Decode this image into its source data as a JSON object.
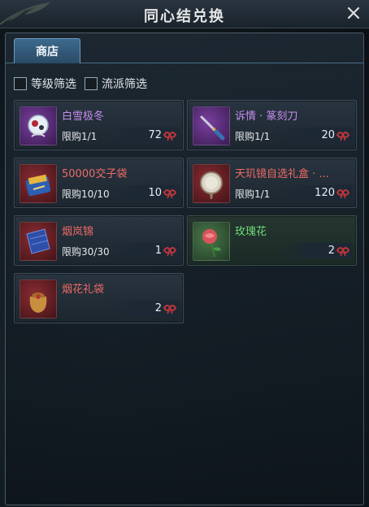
{
  "window": {
    "title": "同心结兑换"
  },
  "tabs": [
    {
      "label": "商店",
      "active": true
    }
  ],
  "filters": [
    {
      "label": "等级筛选",
      "checked": false
    },
    {
      "label": "流派筛选",
      "checked": false
    }
  ],
  "colors": {
    "purple_name": "#c78bf0",
    "red_name": "#ef6a66",
    "green_name": "#6edc7a",
    "tab_accent": "#3d6a8d"
  },
  "items": [
    {
      "name": "白雪极冬",
      "limit": "限购1/1",
      "price": "72",
      "rarity": "purple",
      "icon": "snow-orb-icon"
    },
    {
      "name": "诉情 · 篆刻刀",
      "limit": "限购1/1",
      "price": "20",
      "rarity": "purple",
      "icon": "carving-knife-icon"
    },
    {
      "name": "50000交子袋",
      "limit": "限购10/10",
      "price": "10",
      "rarity": "red",
      "icon": "money-bag-icon"
    },
    {
      "name": "天玑镜自选礼盒 · ...",
      "limit": "限购1/1",
      "price": "120",
      "rarity": "red",
      "icon": "mirror-icon"
    },
    {
      "name": "烟岚锦",
      "limit": "限购30/30",
      "price": "1",
      "rarity": "red",
      "icon": "brocade-icon"
    },
    {
      "name": "玫瑰花",
      "limit": "",
      "price": "2",
      "rarity": "green",
      "icon": "rose-icon"
    },
    {
      "name": "烟花礼袋",
      "limit": "",
      "price": "2",
      "rarity": "red",
      "icon": "gift-pouch-icon"
    }
  ],
  "currency_icon": "concentric-knot-icon"
}
